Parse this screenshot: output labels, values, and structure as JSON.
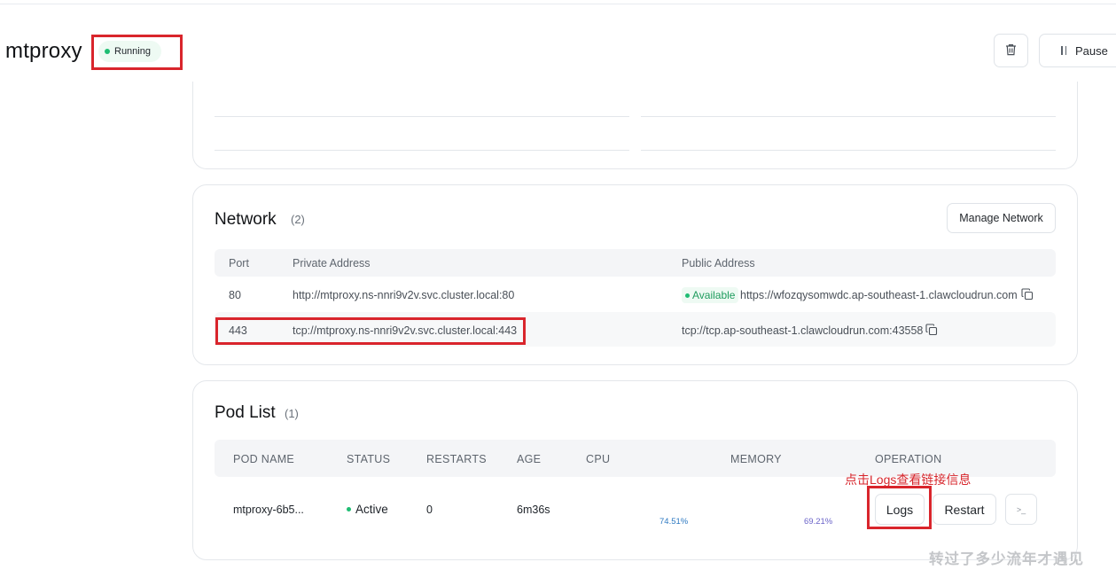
{
  "app": {
    "name": "mtproxy",
    "status": "Running",
    "pause_label": "Pause"
  },
  "network": {
    "title": "Network",
    "count": "(2)",
    "manage_label": "Manage Network",
    "columns": {
      "port": "Port",
      "private": "Private Address",
      "public": "Public Address"
    },
    "rows": [
      {
        "port": "80",
        "private": "http://mtproxy.ns-nnri9v2v.svc.cluster.local:80",
        "badge": "Available",
        "public": "https://wfozqysomwdc.ap-southeast-1.clawcloudrun.com"
      },
      {
        "port": "443",
        "private": "tcp://mtproxy.ns-nnri9v2v.svc.cluster.local:443",
        "public": "tcp://tcp.ap-southeast-1.clawcloudrun.com:43558"
      }
    ]
  },
  "pods": {
    "title": "Pod List",
    "count": "(1)",
    "columns": {
      "name": "POD NAME",
      "status": "STATUS",
      "restarts": "RESTARTS",
      "age": "AGE",
      "cpu": "CPU",
      "memory": "MEMORY",
      "operation": "OPERATION"
    },
    "rows": [
      {
        "name": "mtproxy-6b5...",
        "status": "Active",
        "restarts": "0",
        "age": "6m36s",
        "cpu": "74.51%",
        "memory": "69.21%",
        "logs": "Logs",
        "restart": "Restart",
        "terminal": ">_"
      }
    ]
  },
  "annotation": "点击Logs查看链接信息",
  "watermark": "转过了多少流年才遇见",
  "colors": {
    "accent_red": "#d9252c",
    "status_green": "#1fbd73",
    "cpu_blue": "#2d79c2",
    "memory_purple": "#6b64c9"
  }
}
